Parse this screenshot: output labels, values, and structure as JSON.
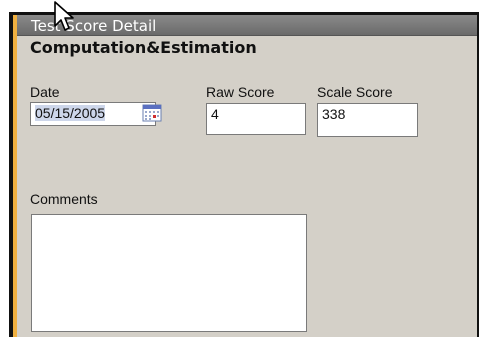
{
  "window": {
    "title": "Test Score Detail"
  },
  "section": {
    "title": "Computation&Estimation"
  },
  "fields": {
    "date": {
      "label": "Date",
      "value": "05/15/2005"
    },
    "raw_score": {
      "label": "Raw Score",
      "value": "4"
    },
    "scale_score": {
      "label": "Scale Score",
      "value": "338"
    },
    "comments": {
      "label": "Comments",
      "value": ""
    }
  },
  "icons": {
    "calendar": "calendar-icon",
    "cursor": "mouse-pointer-icon"
  },
  "colors": {
    "frame_border": "#f0b040",
    "panel_bg": "#d4d0c8",
    "titlebar": "#7a7a7a",
    "date_highlight": "#cdd6ea"
  }
}
